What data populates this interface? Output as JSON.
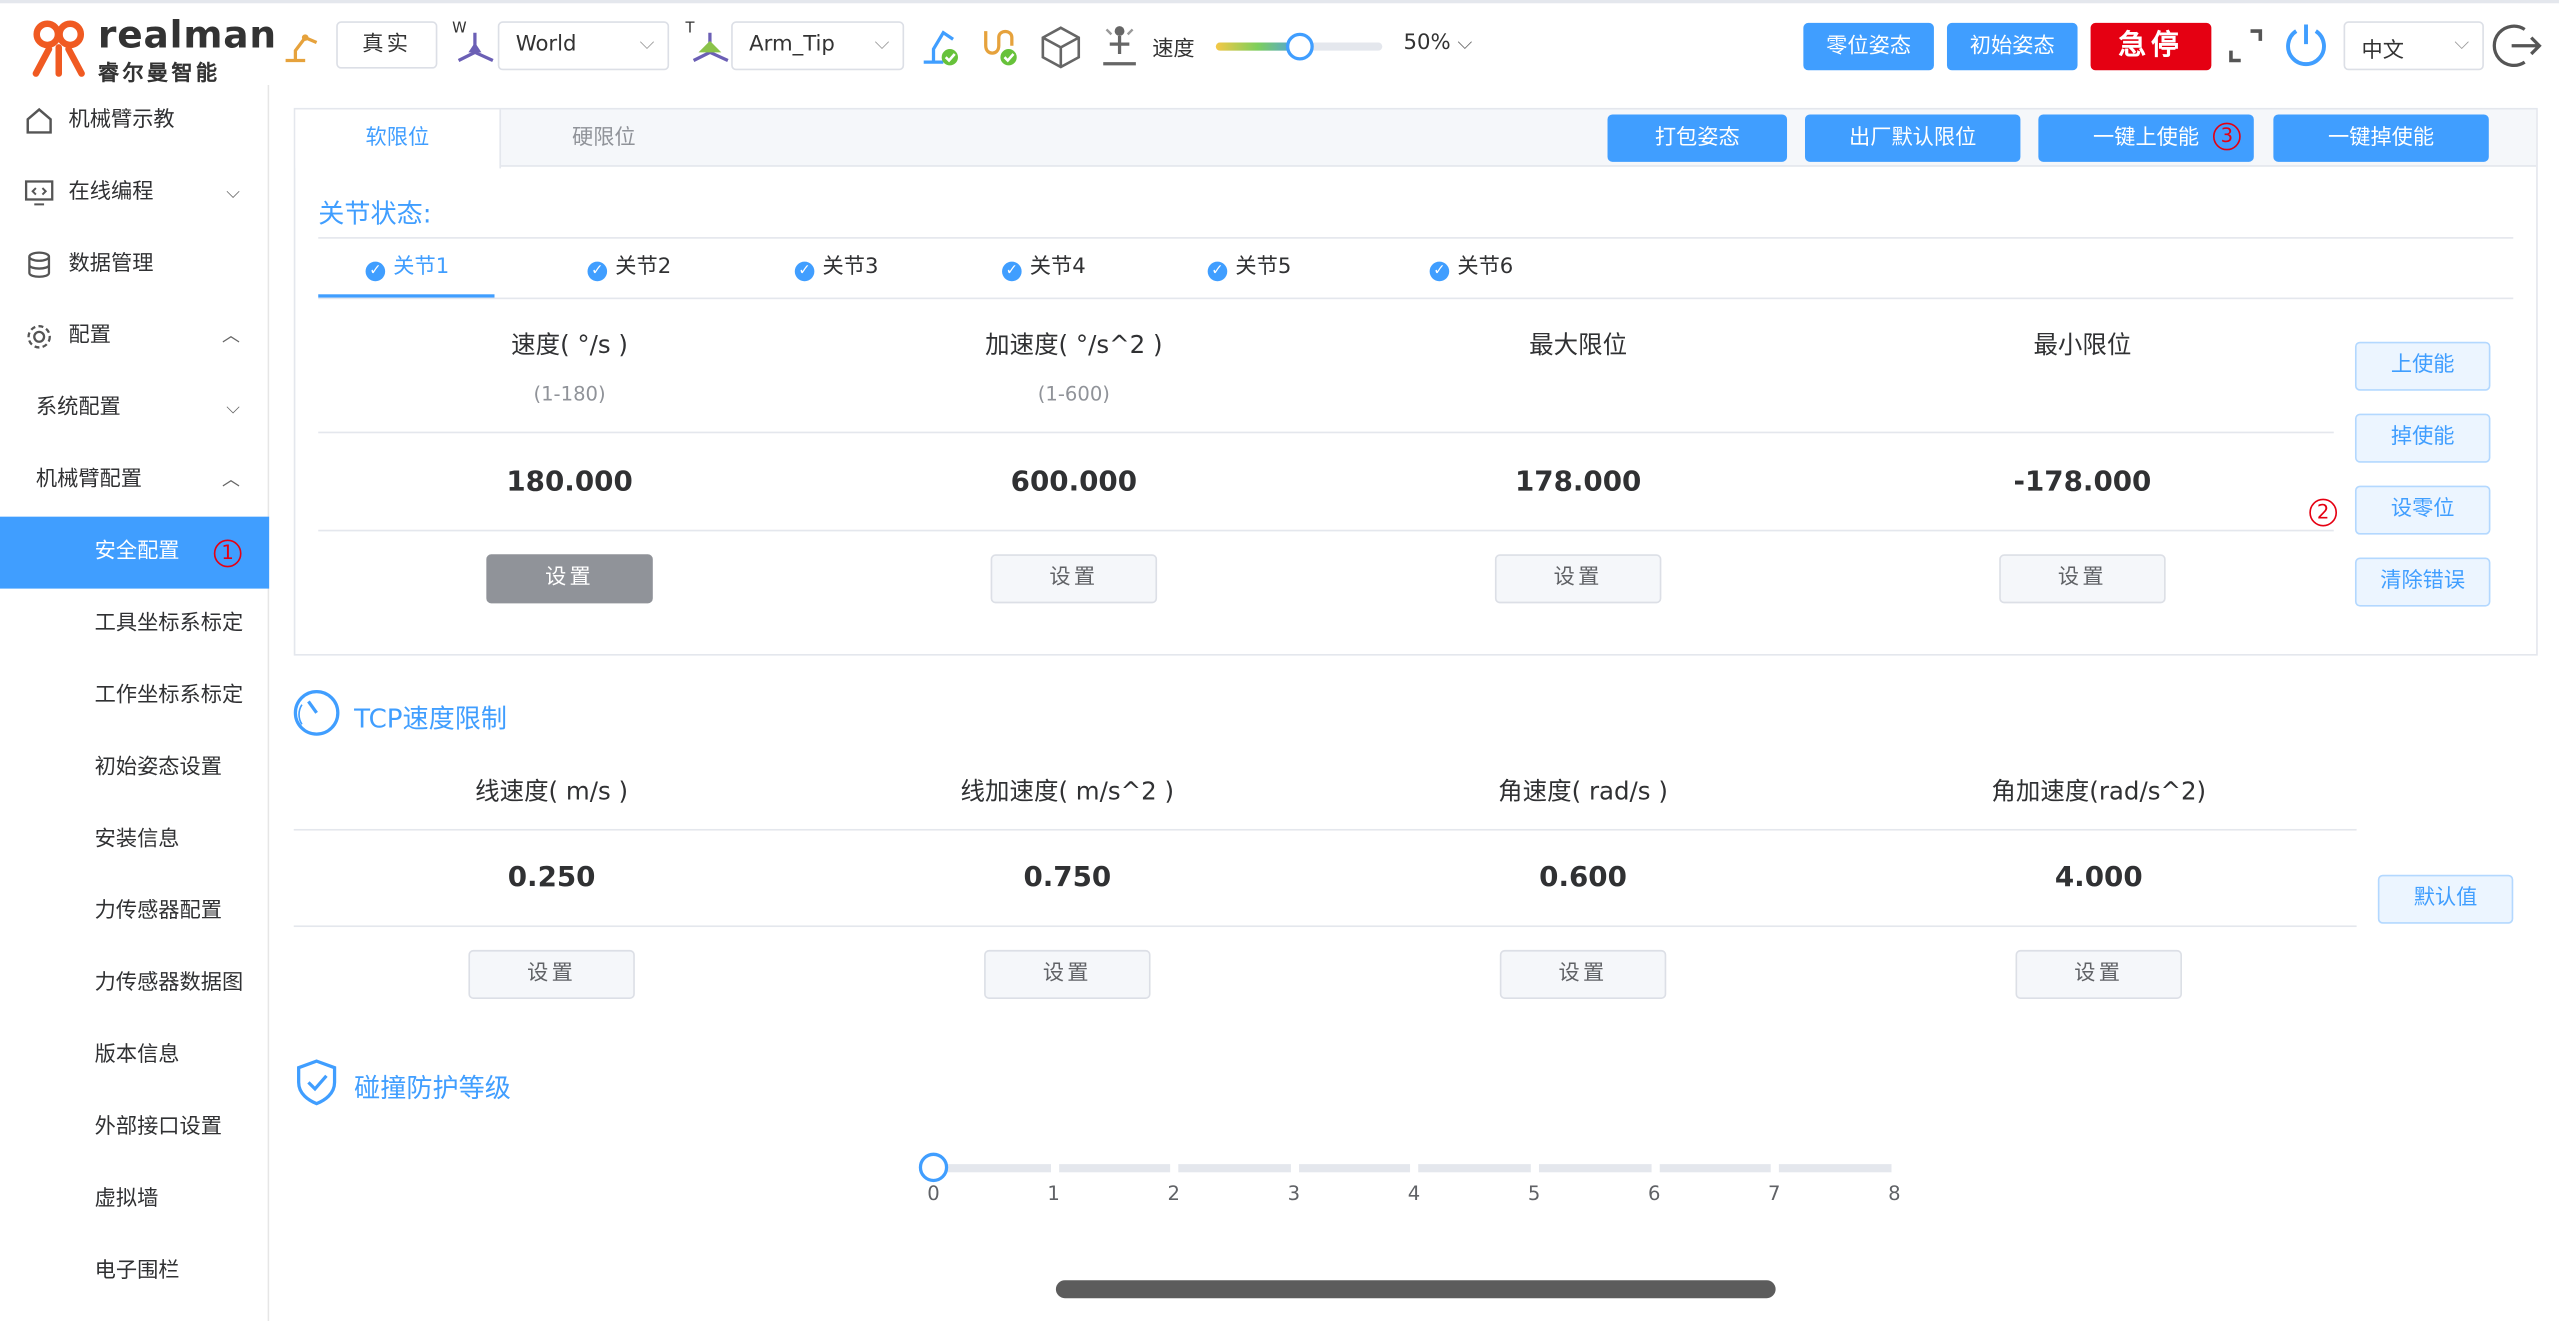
{
  "header": {
    "logo_en": "realman",
    "logo_cn": "睿尔曼智能",
    "mode_label": "真实",
    "work_frame_sup": "W",
    "work_frame": "World",
    "tool_frame_sup": "T",
    "tool_frame": "Arm_Tip",
    "speed_label": "速度",
    "speed_value": 50,
    "speed_text": "50%",
    "buttons": {
      "zero_pose": "零位姿态",
      "init_pose": "初始姿态",
      "estop": "急停"
    },
    "language": "中文"
  },
  "sidebar": {
    "items": [
      {
        "label": "机械臂示教"
      },
      {
        "label": "在线编程"
      },
      {
        "label": "数据管理"
      },
      {
        "label": "配置"
      },
      {
        "label": "系统配置"
      },
      {
        "label": "机械臂配置"
      },
      {
        "label": "安全配置",
        "badge": "1"
      },
      {
        "label": "工具坐标系标定"
      },
      {
        "label": "工作坐标系标定"
      },
      {
        "label": "初始姿态设置"
      },
      {
        "label": "安装信息"
      },
      {
        "label": "力传感器配置"
      },
      {
        "label": "力传感器数据图"
      },
      {
        "label": "版本信息"
      },
      {
        "label": "外部接口设置"
      },
      {
        "label": "虚拟墙"
      },
      {
        "label": "电子围栏"
      }
    ]
  },
  "limits": {
    "tabs": [
      "软限位",
      "硬限位"
    ],
    "actions": {
      "pack_pose": "打包姿态",
      "factory_default": "出厂默认限位",
      "enable_all": "一键上使能",
      "enable_all_badge": "3",
      "disable_all": "一键掉使能"
    },
    "joint_status_title": "关节状态:",
    "joints": [
      "关节1",
      "关节2",
      "关节3",
      "关节4",
      "关节5",
      "关节6"
    ],
    "columns": [
      {
        "header": "速度( °/s )",
        "range": "(1-180)",
        "value": "180.000",
        "button": "设置"
      },
      {
        "header": "加速度( °/s^2 )",
        "range": "(1-600)",
        "value": "600.000",
        "button": "设置"
      },
      {
        "header": "最大限位",
        "range": "",
        "value": "178.000",
        "button": "设置"
      },
      {
        "header": "最小限位",
        "range": "",
        "value": "-178.000",
        "button": "设置"
      }
    ],
    "side_buttons": {
      "enable": "上使能",
      "disable": "掉使能",
      "set_zero": "设零位",
      "set_zero_badge": "2",
      "clear_error": "清除错误"
    }
  },
  "tcp": {
    "title": "TCP速度限制",
    "columns": [
      {
        "header": "线速度( m/s )",
        "value": "0.250",
        "button": "设置"
      },
      {
        "header": "线加速度( m/s^2 )",
        "value": "0.750",
        "button": "设置"
      },
      {
        "header": "角速度( rad/s )",
        "value": "0.600",
        "button": "设置"
      },
      {
        "header": "角加速度(rad/s^2)",
        "value": "4.000",
        "button": "设置"
      }
    ],
    "default_button": "默认值"
  },
  "collision": {
    "title": "碰撞防护等级",
    "level": 0,
    "levels": [
      "0",
      "1",
      "2",
      "3",
      "4",
      "5",
      "6",
      "7",
      "8"
    ]
  },
  "colors": {
    "accent": "#409eff",
    "estop": "#e50012",
    "logo_orange": "#f05a22"
  }
}
